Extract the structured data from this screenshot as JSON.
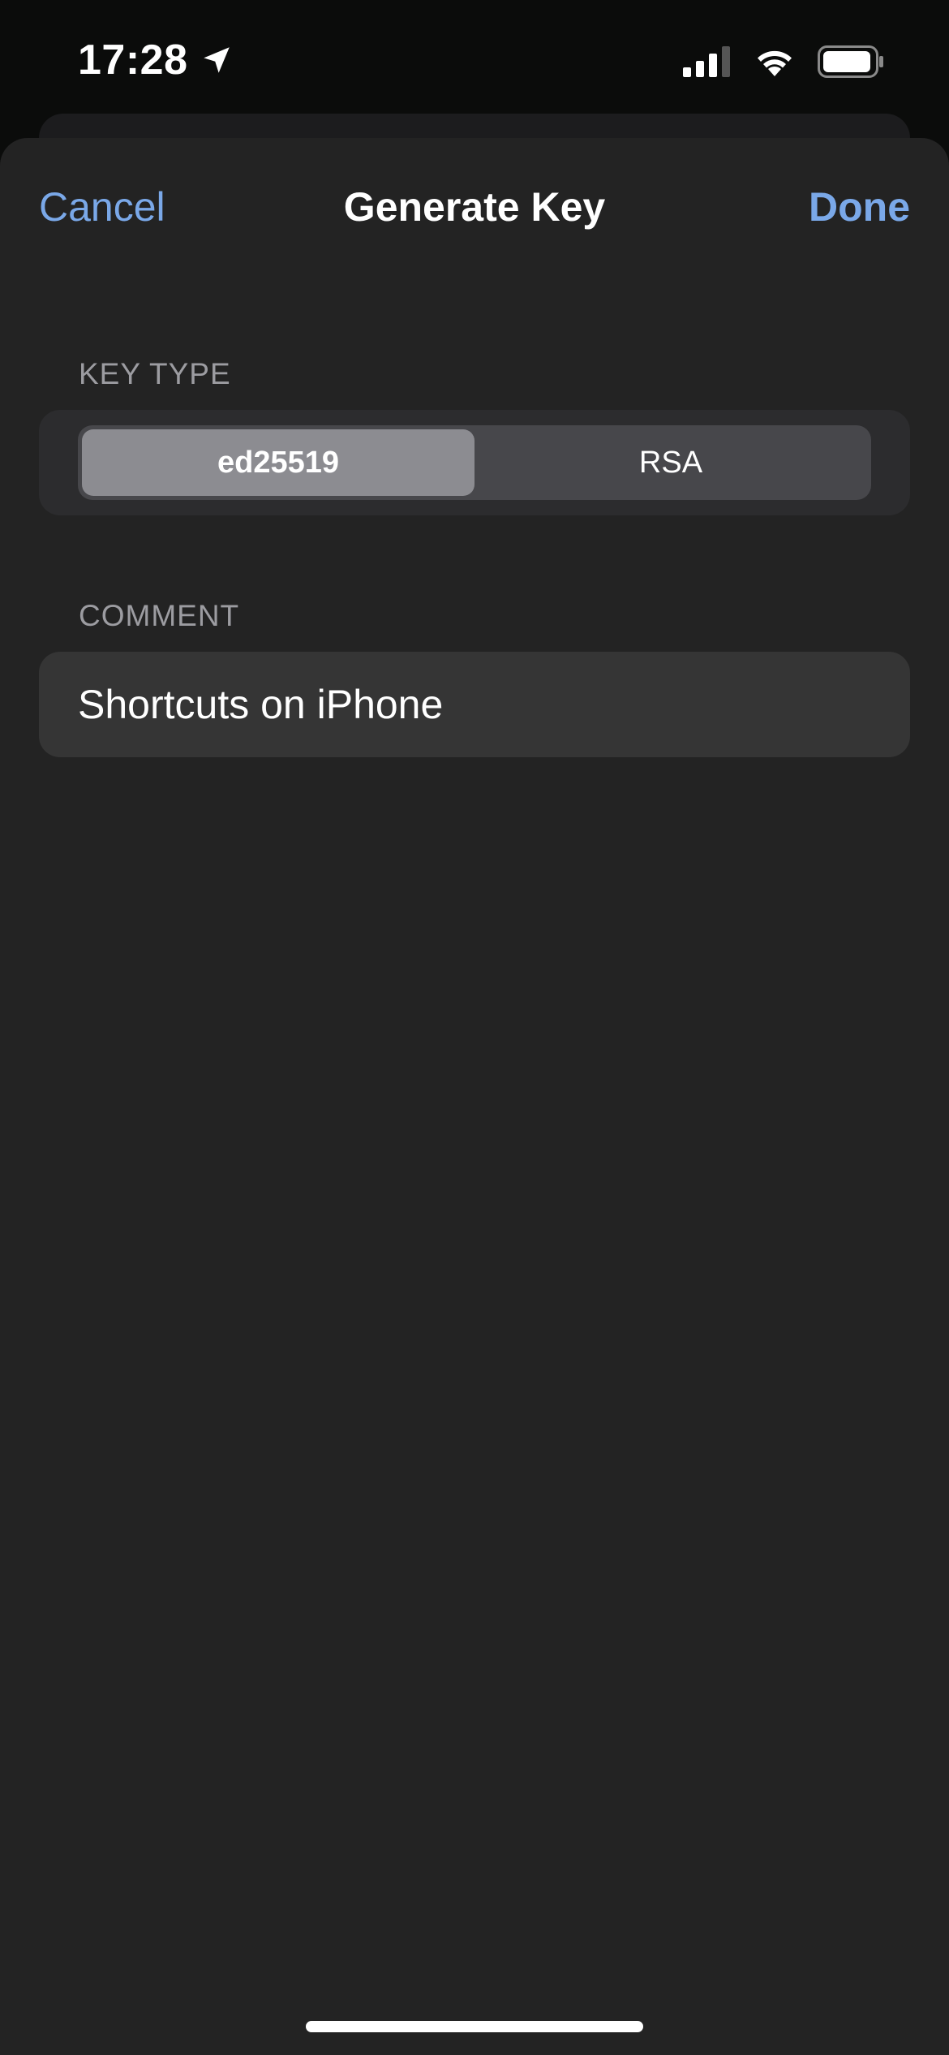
{
  "status_bar": {
    "time": "17:28",
    "icons": [
      "location-arrow-icon",
      "cellular-signal-icon",
      "wifi-icon",
      "battery-icon"
    ]
  },
  "nav": {
    "cancel_label": "Cancel",
    "title": "Generate Key",
    "done_label": "Done"
  },
  "key_type": {
    "header": "KEY TYPE",
    "options": [
      {
        "label": "ed25519",
        "selected": true
      },
      {
        "label": "RSA",
        "selected": false
      }
    ]
  },
  "comment": {
    "header": "COMMENT",
    "value": "Shortcuts on iPhone"
  },
  "colors": {
    "accent": "#7aa8e8",
    "sheet_background": "#232323",
    "group_background": "#2c2c2e",
    "segment_selected": "#8c8c91"
  }
}
